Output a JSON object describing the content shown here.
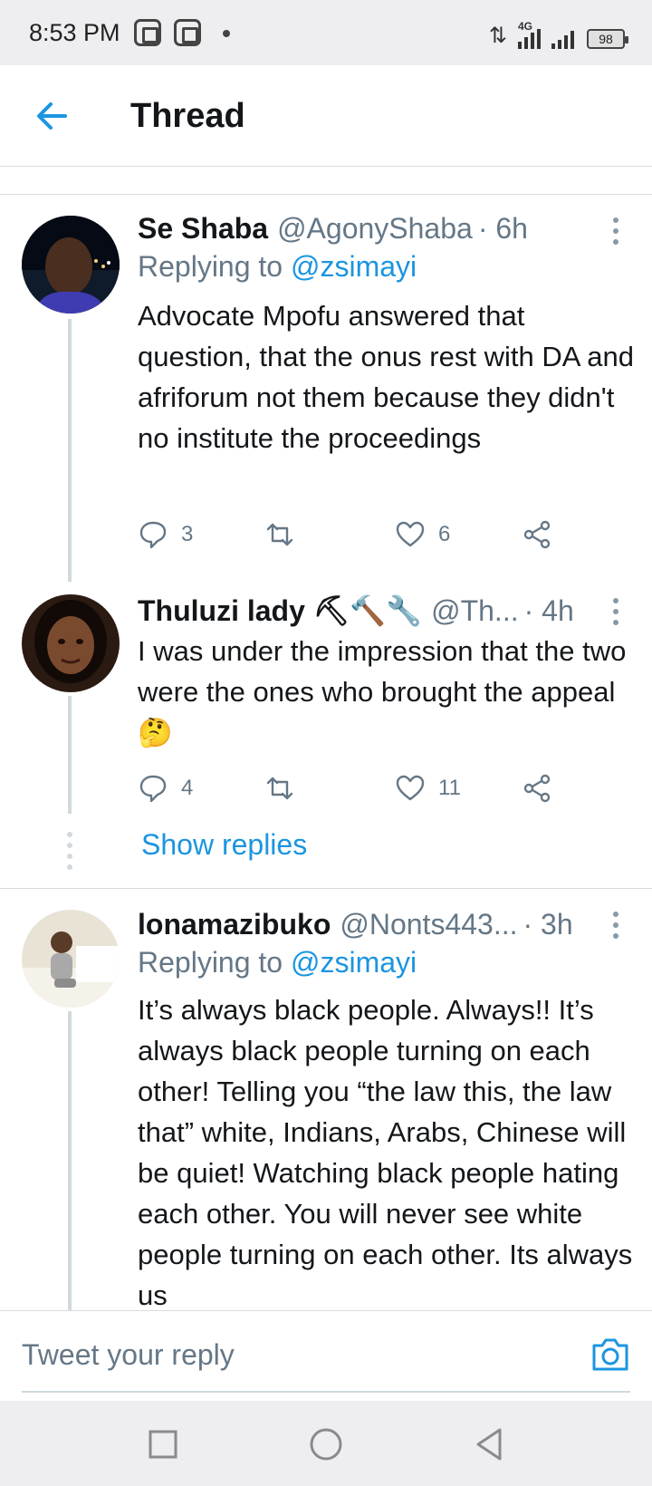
{
  "status_bar": {
    "time": "8:53 PM",
    "network": "4G",
    "battery": "98"
  },
  "header": {
    "title": "Thread"
  },
  "tweets": [
    {
      "name": "Se Shaba",
      "handle": "@AgonyShaba",
      "time": "· 6h",
      "replying_prefix": "Replying to",
      "replying_to": "@zsimayi",
      "text": "Advocate Mpofu answered that question, that the onus  rest with DA and afriforum not them because they didn't no institute the proceedings",
      "replies": "3",
      "retweets": "",
      "likes": "6"
    },
    {
      "name": "Thuluzi lady ⛏🔨🔧",
      "handle": "@Th...",
      "time": "· 4h",
      "text": "I was under the impression that the two were the ones who brought the appeal 🤔",
      "replies": "4",
      "retweets": "",
      "likes": "11",
      "show_replies": "Show replies"
    },
    {
      "name": "lonamazibuko",
      "handle": "@Nonts443...",
      "time": "· 3h",
      "replying_prefix": "Replying to",
      "replying_to": "@zsimayi",
      "text": "It’s always black people. Always!! It’s always black people turning on each other! Telling you “the law this, the law that” white, Indians, Arabs, Chinese will be quiet! Watching black people hating each other. You will never see white people turning on each other. Its always us"
    }
  ],
  "reply_bar": {
    "placeholder": "Tweet your reply"
  },
  "colors": {
    "accent": "#1b95e0",
    "secondary_text": "#657786",
    "divider": "#d8dde1"
  },
  "icons": [
    "back-arrow-icon",
    "more-vertical-icon",
    "reply-icon",
    "retweet-icon",
    "like-icon",
    "share-icon",
    "camera-icon",
    "square-nav-icon",
    "circle-nav-icon",
    "triangle-back-nav-icon"
  ]
}
